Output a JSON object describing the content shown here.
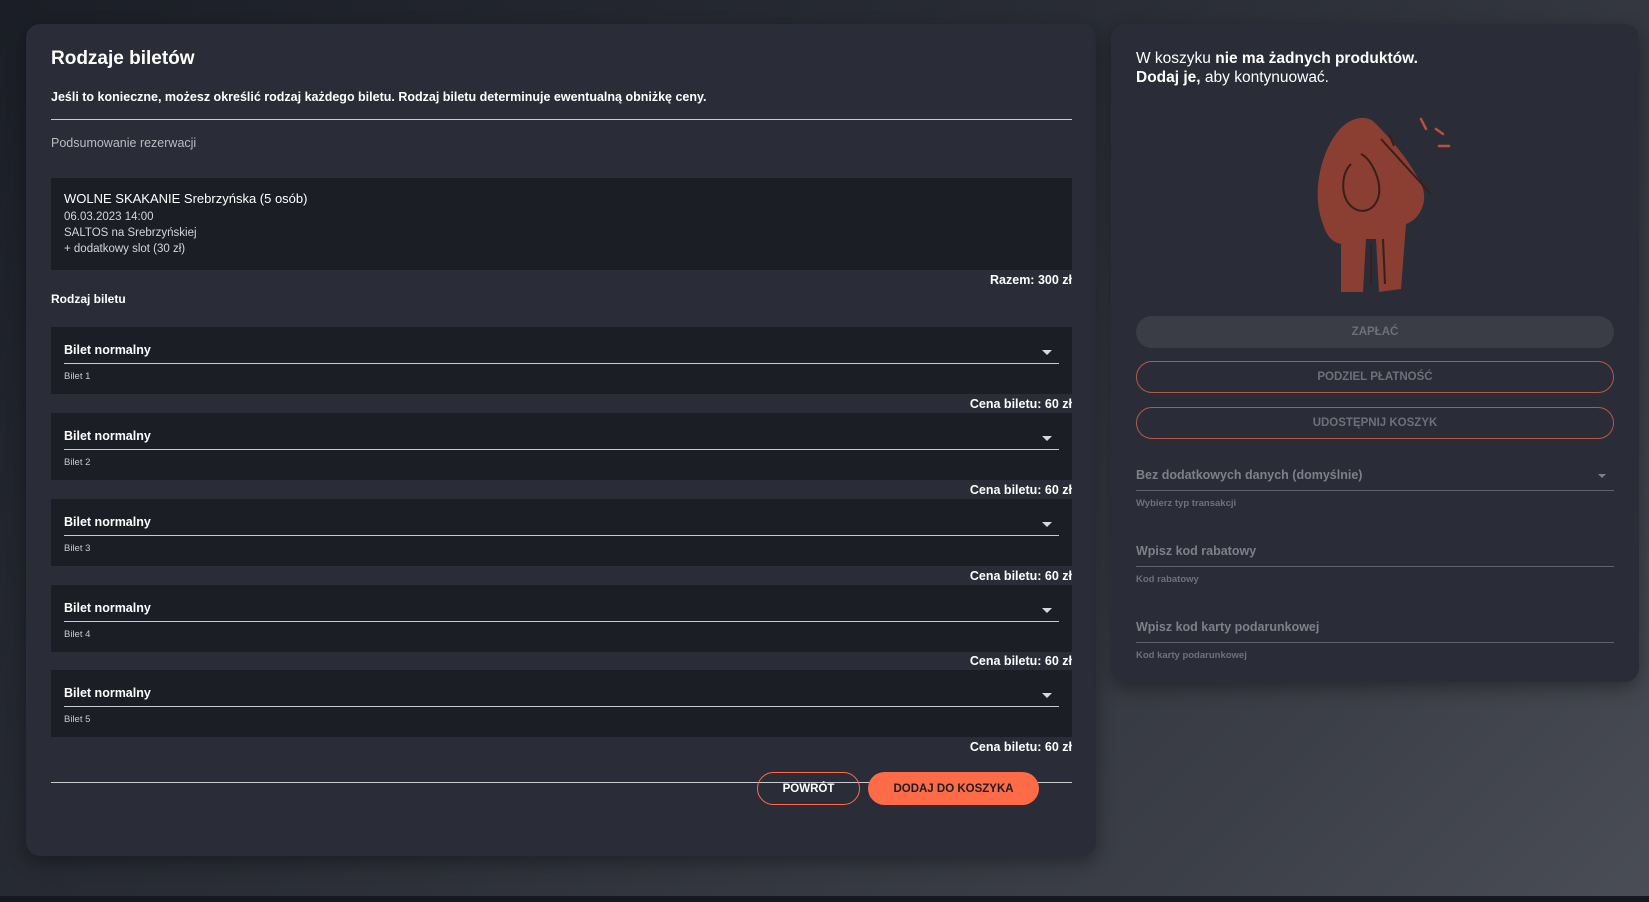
{
  "main": {
    "title": "Rodzaje biletów",
    "subtitle": "Jeśli to konieczne, możesz określić rodzaj każdego biletu. Rodzaj biletu determinuje ewentualną obniżkę ceny.",
    "summary_label": "Podsumowanie rezerwacji",
    "summary": {
      "product": "WOLNE SKAKANIE Srebrzyńska (5 osób)",
      "datetime": "06.03.2023 14:00",
      "location": "SALTOS na Srebrzyńskiej",
      "extra": "+ dodatkowy slot (30 zł)"
    },
    "total": "Razem: 300 zł",
    "ticket_type_label": "Rodzaj biletu",
    "tickets": [
      {
        "type": "Bilet normalny",
        "helper": "Bilet 1",
        "price": "Cena biletu: 60 zł"
      },
      {
        "type": "Bilet normalny",
        "helper": "Bilet 2",
        "price": "Cena biletu: 60 zł"
      },
      {
        "type": "Bilet normalny",
        "helper": "Bilet 3",
        "price": "Cena biletu: 60 zł"
      },
      {
        "type": "Bilet normalny",
        "helper": "Bilet 4",
        "price": "Cena biletu: 60 zł"
      },
      {
        "type": "Bilet normalny",
        "helper": "Bilet 5",
        "price": "Cena biletu: 60 zł"
      }
    ],
    "back_label": "POWRÓT",
    "add_label": "DODAJ DO KOSZYKA"
  },
  "cart": {
    "msg_part1": "W koszyku ",
    "msg_bold1": "nie ma żadnych produktów.",
    "msg_bold2": "Dodaj je,",
    "msg_part2": " aby kontynuować.",
    "pay_label": "ZAPŁAĆ",
    "split_label": "PODZIEL PŁATNOŚĆ",
    "share_label": "UDOSTĘPNIJ KOSZYK",
    "transaction": {
      "value": "Bez dodatkowych danych (domyślnie)",
      "help": "Wybierz typ transakcji"
    },
    "discount": {
      "placeholder": "Wpisz kod rabatowy",
      "help": "Kod rabatowy"
    },
    "giftcard": {
      "placeholder": "Wpisz kod karty podarunkowej",
      "help": "Kod karty podarunkowej"
    }
  },
  "colors": {
    "accent": "#ff6a47",
    "panel": "#2a2d37",
    "box": "#1c1e26",
    "illustration": "#8b3e32"
  },
  "icons": [
    "dropdown-arrow-icon",
    "empty-cart-illustration"
  ]
}
